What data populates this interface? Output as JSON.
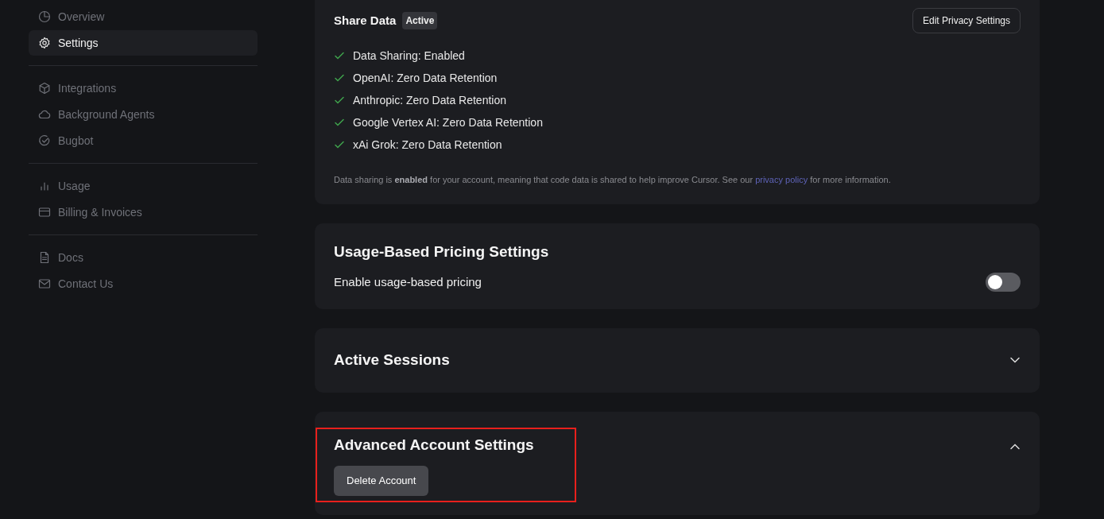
{
  "sidebar": {
    "groups": [
      {
        "items": [
          {
            "label": "Overview",
            "selected": false
          },
          {
            "label": "Settings",
            "selected": true
          }
        ]
      },
      {
        "items": [
          {
            "label": "Integrations",
            "selected": false
          },
          {
            "label": "Background Agents",
            "selected": false
          },
          {
            "label": "Bugbot",
            "selected": false
          }
        ]
      },
      {
        "items": [
          {
            "label": "Usage",
            "selected": false
          },
          {
            "label": "Billing & Invoices",
            "selected": false
          }
        ]
      },
      {
        "items": [
          {
            "label": "Docs",
            "selected": false
          },
          {
            "label": "Contact Us",
            "selected": false
          }
        ]
      }
    ]
  },
  "share_data": {
    "title": "Share Data",
    "badge": "Active",
    "button": "Edit Privacy Settings",
    "checks": [
      "Data Sharing: Enabled",
      "OpenAI: Zero Data Retention",
      "Anthropic: Zero Data Retention",
      "Google Vertex AI: Zero Data Retention",
      "xAi Grok: Zero Data Retention"
    ],
    "note_before": "Data sharing is **enabled** for your account, meaning that code data is shared to help improve Cursor. See our ",
    "note_link": "privacy policy",
    "note_after": " for more information."
  },
  "usage_pricing": {
    "title": "Usage-Based Pricing Settings",
    "label": "Enable usage-based pricing",
    "on": false
  },
  "active_sessions": {
    "title": "Active Sessions",
    "expanded": false
  },
  "advanced": {
    "title": "Advanced Account Settings",
    "expanded": true,
    "button": "Delete Account",
    "highlighted": true
  }
}
